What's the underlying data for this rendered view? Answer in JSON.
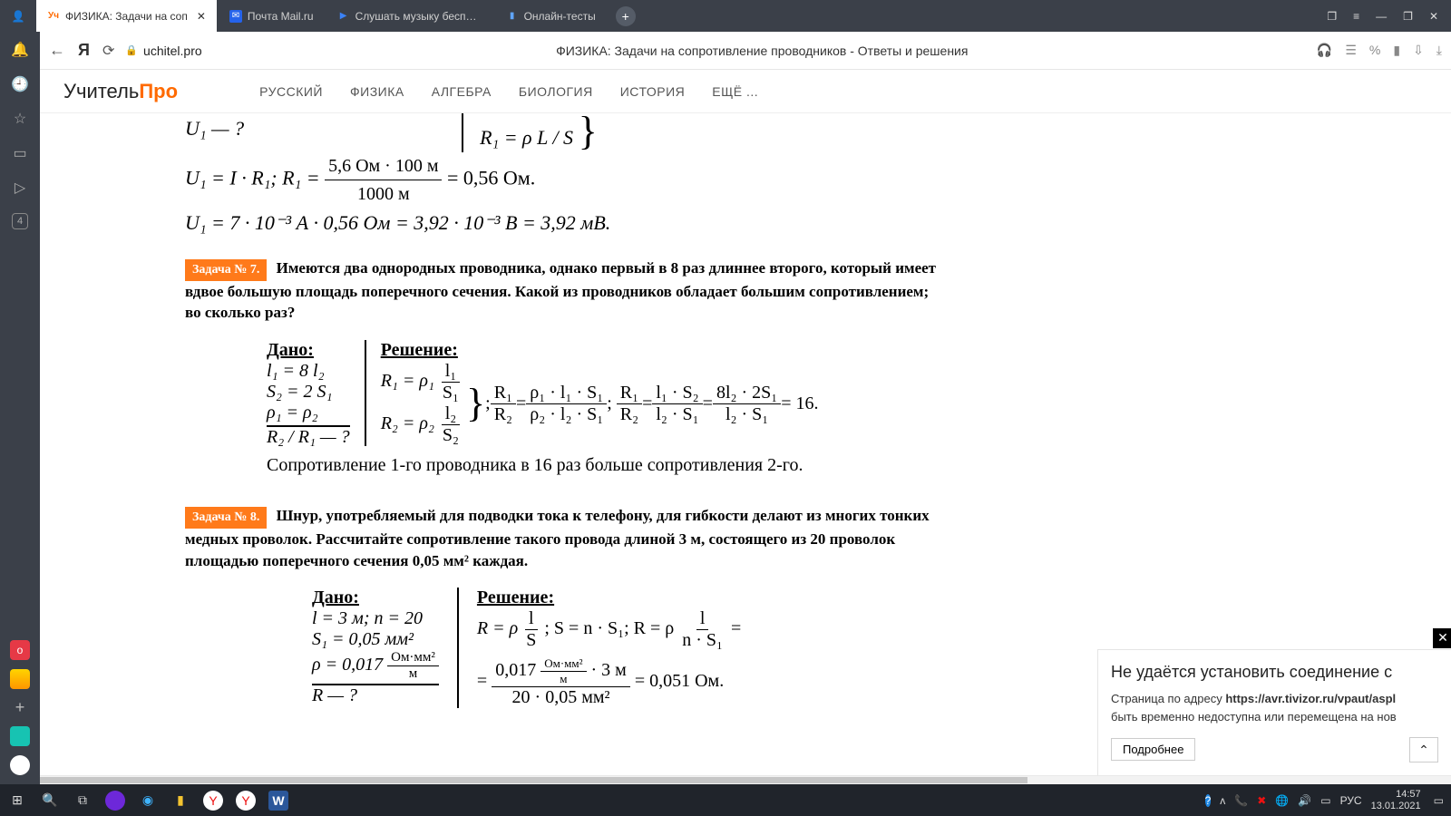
{
  "titlebar": {
    "tabs": [
      {
        "favicon": "Уч",
        "title": "ФИЗИКА: Задачи на соп",
        "active": true,
        "close": "✕"
      },
      {
        "favicon": "✉",
        "title": "Почта Mail.ru"
      },
      {
        "favicon": "▶",
        "title": "Слушать музыку бесплат"
      },
      {
        "favicon": "▮",
        "title": "Онлайн-тесты"
      }
    ],
    "new": "+",
    "win_ctrls": [
      "❐",
      "≡",
      "—",
      "❐",
      "✕"
    ]
  },
  "addrbar": {
    "back": "←",
    "ya": "Я",
    "reload": "⟳",
    "lock": "🔒",
    "domain": "uchitel.pro",
    "page_title": "ФИЗИКА: Задачи на сопротивление проводников - Ответы и решения",
    "icons": [
      "🎧",
      "☰",
      "%",
      "▮",
      "⇩",
      "⤓"
    ]
  },
  "sidebar": {
    "items": [
      "🔔",
      "🕘",
      "☆",
      "▭",
      "▷"
    ],
    "badge": "4",
    "bottom_red": "о",
    "bottom_plus": "+"
  },
  "site": {
    "brand_a": "Учитель",
    "brand_b": "Про",
    "nav": [
      "РУССКИЙ",
      "ФИЗИКА",
      "АЛГЕБРА",
      "БИОЛОГИЯ",
      "ИСТОРИЯ",
      "ЕЩЁ ..."
    ]
  },
  "content": {
    "top_math": {
      "line0_right": "R₁ = ρ ⁠L / S",
      "u1q": "U₁ — ?",
      "line1": "U₁ = I · R₁;   R₁ =",
      "frac_num": "5,6 Ом · 100 м",
      "frac_den": "1000 м",
      "eq_res": "= 0,56 Ом.",
      "line2": "U₁ = 7 · 10⁻³ А · 0,56 Ом = 3,92 · 10⁻³ В = 3,92 мВ."
    },
    "p7": {
      "badge": "Задача № 7.",
      "text": "Имеются два однородных проводника, однако первый в 8 раз длиннее второго, который имеет вдвое большую площадь поперечного сечения. Какой из проводников обладает большим сопротивлением; во сколько раз?",
      "given_title": "Дано:",
      "solution_title": "Решение:",
      "g1": "l₁ = 8 l₂",
      "g2": "S₂ = 2 S₁",
      "g3": "ρ₁ = ρ₂",
      "ask": "R₂ / R₁ — ?",
      "sol_r1": "R₁ = ρ₁",
      "sol_r1_fn": "l₁",
      "sol_r1_fd": "S₁",
      "sol_r2": "R₂ = ρ₂",
      "sol_r2_fn": "l₂",
      "sol_r2_fd": "S₂",
      "ratio_a": ";  ",
      "ratio1_n": "R₁",
      "ratio1_d": "R₂",
      "eq1": " = ",
      "ratio2_n": "ρ₁ · l₁ · S₁",
      "ratio2_d": "ρ₂ · l₂ · S₁",
      "ratio3_n": "R₁",
      "ratio3_d": "R₂",
      "ratio4_n": "l₁ · S₂",
      "ratio4_d": "l₂ · S₁",
      "ratio5_n": "8l₂ · 2S₁",
      "ratio5_d": "l₂ · S₁",
      "eq16": " = 16.",
      "conclusion": "Сопротивление 1-го проводника в 16 раз больше сопротивления 2-го."
    },
    "p8": {
      "badge": "Задача № 8.",
      "text": "Шнур, употребляемый для подводки тока к телефону, для гибкости делают из многих тонких медных проволок. Рассчитайте сопротивление такого провода длиной 3 м, состоящего из 20 проволок площадью поперечного сечения 0,05 мм² каждая.",
      "given_title": "Дано:",
      "solution_title": "Решение:",
      "g1": "l = 3 м;  n = 20",
      "g2": "S₁ = 0,05 мм²",
      "g3": "ρ = 0,017",
      "g3_fn": "Ом·мм²",
      "g3_fd": "м",
      "ask": "R — ?",
      "s_line1": "R = ρ",
      "s_f1n": "l",
      "s_f1d": "S",
      "s_semi": ";   S = n · S₁;   R = ρ",
      "s_f2n": "l",
      "s_f2d": "n · S₁",
      "s_eq": " =",
      "s_calc_pre": "=",
      "s_calc_num": "0,017 Ом·мм² / м · 3 м",
      "s_calc_n1": "0,017",
      "s_calc_unit_n": "Ом·мм²",
      "s_calc_unit_d": "м",
      "s_calc_mul": " · 3 м",
      "s_calc_den": "20 · 0,05 мм²",
      "s_res": " = 0,051 Ом."
    }
  },
  "error": {
    "title": "Не удаётся установить соединение с",
    "desc_pre": "Страница по адресу ",
    "url": "https://avr.tivizor.ru/vpaut/aspl",
    "desc_post": "быть временно недоступна или перемещена на нов",
    "more": "Подробнее",
    "close": "✕",
    "chev": "⌃"
  },
  "taskbar": {
    "left": [
      "⊞",
      "🔍",
      "⧉",
      "●",
      "◉",
      "▮",
      "▭",
      "Я",
      "Я",
      "W"
    ],
    "right_icons": [
      "?",
      "ᴧ",
      "📞",
      "🌐",
      "🔊",
      "▭"
    ],
    "lang": "РУС",
    "time": "14:57",
    "date": "13.01.2021"
  }
}
